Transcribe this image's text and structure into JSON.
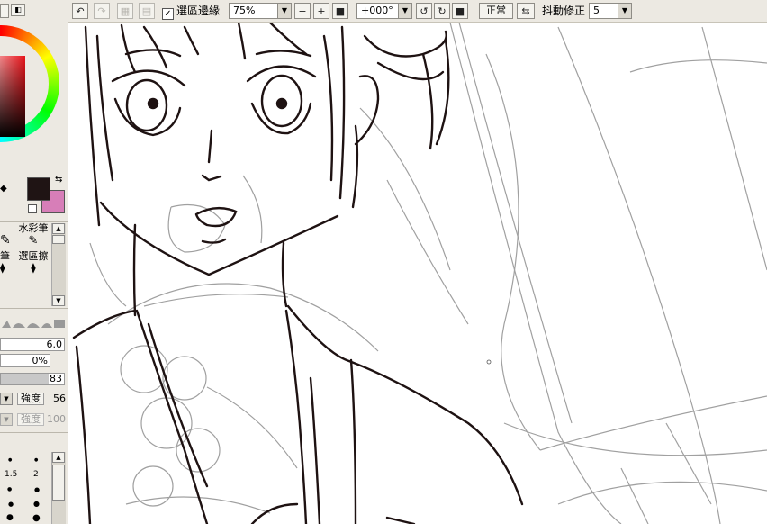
{
  "toolbar": {
    "undo_icon": "undo-icon",
    "redo_icon": "redo-icon",
    "selection_edge_label": "選區邊緣",
    "selection_edge_checked": true,
    "zoom_value": "75%",
    "rotation_value": "+000°",
    "blend_mode": "正常",
    "stabilizer_label": "抖動修正",
    "stabilizer_value": "5"
  },
  "colors": {
    "primary": "#1f1414",
    "secondary": "#d77eb8"
  },
  "tools": {
    "row1_right": "水彩筆",
    "row2_left": "筆",
    "row2_right": "選區擦"
  },
  "brush": {
    "size_value": "6.0",
    "min_size_value": "0%",
    "density_value": "83",
    "strength_label": "強度",
    "strength_value": "56",
    "strength2_label": "強度",
    "strength2_value": "100"
  },
  "size_presets": [
    "1.5",
    "2"
  ]
}
